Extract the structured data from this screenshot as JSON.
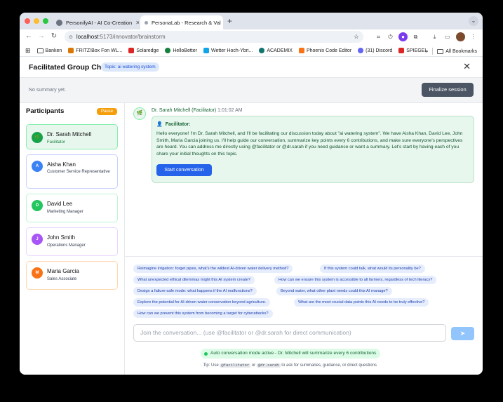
{
  "browser": {
    "tabs": [
      {
        "title": "PersonifyAI - AI Co-Creation",
        "favicon_color": "#6b7280"
      },
      {
        "title": "PersonaLab - Research & Val",
        "favicon_color": "#9ca3af",
        "active": true
      }
    ],
    "url_host": "localhost",
    "url_path": ":5173/innovator/brainstorm",
    "bookmarks": [
      {
        "label": "Banken",
        "type": "folder"
      },
      {
        "label": "FRITZ!Box Fon WL...",
        "color": "#d97706"
      },
      {
        "label": "Solaredge",
        "color": "#dc2626"
      },
      {
        "label": "HelloBetter",
        "color": "#15803d"
      },
      {
        "label": "Wetter Hoch-Ybri...",
        "color": "#0ea5e9"
      },
      {
        "label": "ACADEMIX",
        "color": "#0f766e"
      },
      {
        "label": "Phoenix Code Editor",
        "color": "#f97316"
      },
      {
        "label": "(31) Discord",
        "color": "#6366f1"
      },
      {
        "label": "SPIEGEL",
        "color": "#dc2626"
      }
    ],
    "bookmarks_more": "»",
    "all_bookmarks": "All Bookmarks"
  },
  "header": {
    "title": "Facilitated Group Chat",
    "topic": "Topic: ai watering system",
    "close": "✕"
  },
  "summary": {
    "text": "No summary yet.",
    "finalize_label": "Finalize session"
  },
  "sidebar": {
    "title": "Participants",
    "pause_label": "Pause",
    "participants": [
      {
        "initial": "🌿",
        "name": "Dr. Sarah Mitchell",
        "role": "Facilitator",
        "color": "#16a34a"
      },
      {
        "initial": "A",
        "name": "Aisha Khan",
        "role": "Customer Service Representative",
        "color": "#3b82f6"
      },
      {
        "initial": "D",
        "name": "David Lee",
        "role": "Marketing Manager",
        "color": "#22c55e"
      },
      {
        "initial": "J",
        "name": "John Smith",
        "role": "Operations Manager",
        "color": "#a855f7"
      },
      {
        "initial": "M",
        "name": "Maria Garcia",
        "role": "Sales Associate",
        "color": "#f97316"
      }
    ]
  },
  "message": {
    "sender": "Dr. Sarah Mitchell (Facilitator)",
    "time": "1:01:02 AM",
    "label": "Facilitator:",
    "body": "Hello everyone! I'm Dr. Sarah Mitchell, and I'll be facilitating our discussion today about \"ai watering system\". We have Aisha Khan, David Lee, John Smith, Maria Garcia joining us. I'll help guide our conversation, summarize key points every 6 contributions, and make sure everyone's perspectives are heard. You can address me directly using @facilitator or @dr.sarah if you need guidance or want a summary. Let's start by having each of you share your initial thoughts on this topic.",
    "start_label": "Start conversation"
  },
  "suggestions": [
    "Reimagine irrigation: forget pipes, what's the wildest AI-driven water delivery method?",
    "If this system could talk, what would its personality be?",
    "What unexpected ethical dilemmas might this AI system create?",
    "How can we ensure this system is accessible to all farmers, regardless of tech literacy?",
    "Design a failure-safe mode: what happens if the AI malfunctions?",
    "Beyond water, what other plant needs could this AI manage?",
    "Explore the potential for AI-driven water conservation beyond agriculture.",
    "What are the most crucial data points this AI needs to be truly effective?",
    "How can we prevent this system from becoming a target for cyberattacks?"
  ],
  "composer": {
    "placeholder": "Join the conversation... (use @facilitator or @dr.sarah for direct communication)"
  },
  "status": {
    "auto_mode": "Auto conversation mode active - Dr. Mitchell will summarize every 6 contributions",
    "tip_prefix": "Tip: Use",
    "tip_code1": "@facilitator",
    "tip_or": "or",
    "tip_code2": "@dr.sarah",
    "tip_suffix": "to ask for summaries, guidance, or direct questions"
  }
}
